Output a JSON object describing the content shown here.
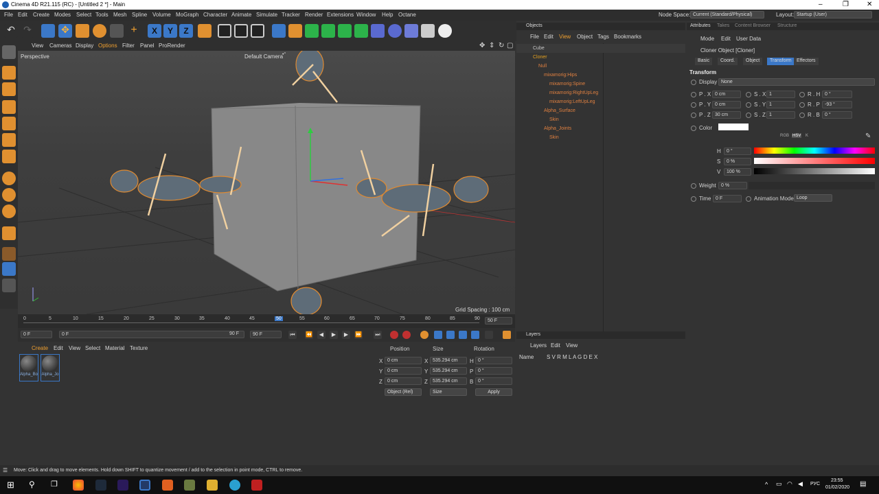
{
  "window": {
    "title": "Cinema 4D R21.115 (RC) - [Untitled 2 *] - Main"
  },
  "menubar": {
    "items": [
      "File",
      "Edit",
      "Create",
      "Modes",
      "Select",
      "Tools",
      "Mesh",
      "Spline",
      "Volume",
      "MoGraph",
      "Character",
      "Animate",
      "Simulate",
      "Tracker",
      "Render",
      "Extensions",
      "Window",
      "Help",
      "Octane"
    ],
    "node_space_label": "Node Space:",
    "node_space_value": "Current (Standard/Physical)",
    "layout_label": "Layout:",
    "layout_value": "Startup (User)"
  },
  "viewport": {
    "menu": [
      "View",
      "Cameras",
      "Display",
      "Options",
      "Filter",
      "Panel",
      "ProRender"
    ],
    "label": "Perspective",
    "camera": "Default Camera",
    "camera_mark": "•°",
    "grid_spacing": "Grid Spacing : 100 cm"
  },
  "timeline": {
    "ticks": [
      "0",
      "5",
      "10",
      "15",
      "20",
      "25",
      "30",
      "35",
      "40",
      "45",
      "50",
      "55",
      "60",
      "65",
      "70",
      "75",
      "80",
      "85",
      "90"
    ],
    "current_frame": "50 F"
  },
  "transport": {
    "start": "0 F",
    "range_start": "0 F",
    "range_end": "90 F",
    "end": "90 F"
  },
  "materials": {
    "menu": [
      "Create",
      "Edit",
      "View",
      "Select",
      "Material",
      "Texture"
    ],
    "items": [
      "Alpha_Bo",
      "Alpha_Jo"
    ]
  },
  "coordinates": {
    "headers": [
      "Position",
      "Size",
      "Rotation"
    ],
    "rows": [
      {
        "axis": "X",
        "pos": "0 cm",
        "size_axis": "X",
        "size": "535.294 cm",
        "rot_axis": "H",
        "rot": "0 °"
      },
      {
        "axis": "Y",
        "pos": "0 cm",
        "size_axis": "Y",
        "size": "535.294 cm",
        "rot_axis": "P",
        "rot": "0 °"
      },
      {
        "axis": "Z",
        "pos": "0 cm",
        "size_axis": "Z",
        "size": "535.294 cm",
        "rot_axis": "B",
        "rot": "0 °"
      }
    ],
    "mode": "Object (Rel)",
    "size_mode": "Size",
    "apply": "Apply"
  },
  "objects": {
    "tab": "Objects",
    "menu": [
      "File",
      "Edit",
      "View",
      "Object",
      "Tags",
      "Bookmarks"
    ],
    "rows": [
      {
        "name": "Cube",
        "color": "#c8c8c8"
      },
      {
        "name": "Cloner",
        "color": "#e3a020"
      },
      {
        "name": "Null",
        "color": "#e08040"
      },
      {
        "name": "mixamorig:Hips",
        "color": "#e08040"
      },
      {
        "name": "mixamorig:Spine",
        "color": "#e08040"
      },
      {
        "name": "mixamorig:RightUpLeg",
        "color": "#e08040"
      },
      {
        "name": "mixamorig:LeftUpLeg",
        "color": "#e08040"
      },
      {
        "name": "Alpha_Surface",
        "color": "#e08040"
      },
      {
        "name": "Skin",
        "color": "#e08040"
      },
      {
        "name": "Alpha_Joints",
        "color": "#e08040"
      },
      {
        "name": "Skin",
        "color": "#e08040"
      }
    ]
  },
  "layers": {
    "tab": "Layers",
    "menu": [
      "Layers",
      "Edit",
      "View"
    ],
    "name_col": "Name",
    "flags": "S V R M L A G D E X"
  },
  "attributes": {
    "tabs": [
      "Attributes",
      "Takes",
      "Content Browser",
      "Structure"
    ],
    "menu": [
      "Mode",
      "Edit",
      "User Data"
    ],
    "object_title": "Cloner Object [Cloner]",
    "subtabs": [
      "Basic",
      "Coord.",
      "Object",
      "Transform",
      "Effectors"
    ],
    "active_subtab": "Transform",
    "section": "Transform",
    "display_label": "Display",
    "display_value": "None",
    "transform_rows": [
      {
        "p": "P . X",
        "pv": "0 cm",
        "s": "S . X",
        "sv": "1",
        "r": "R . H",
        "rv": "0 °"
      },
      {
        "p": "P . Y",
        "pv": "0 cm",
        "s": "S . Y",
        "sv": "1",
        "r": "R . P",
        "rv": "-93 °"
      },
      {
        "p": "P . Z",
        "pv": "30 cm",
        "s": "S . Z",
        "sv": "1",
        "r": "R . B",
        "rv": "0 °"
      }
    ],
    "color_label": "Color",
    "color_modes": [
      "RGB",
      "HSV",
      "K"
    ],
    "hsv": [
      {
        "l": "H",
        "v": "0 °"
      },
      {
        "l": "S",
        "v": "0 %"
      },
      {
        "l": "V",
        "v": "100 %"
      }
    ],
    "weight_label": "Weight",
    "weight_value": "0 %",
    "time_label": "Time",
    "time_value": "0 F",
    "anim_label": "Animation Mode",
    "anim_value": "Loop"
  },
  "status": {
    "text": "Move: Click and drag to move elements. Hold down SHIFT to quantize movement / add to the selection in point mode, CTRL to remove."
  },
  "taskbar": {
    "lang": "РУС",
    "time": "23:55",
    "date": "01/02/2020"
  },
  "colors": {
    "accent": "#3b78c8",
    "orange": "#e08040",
    "bg": "#333333"
  }
}
